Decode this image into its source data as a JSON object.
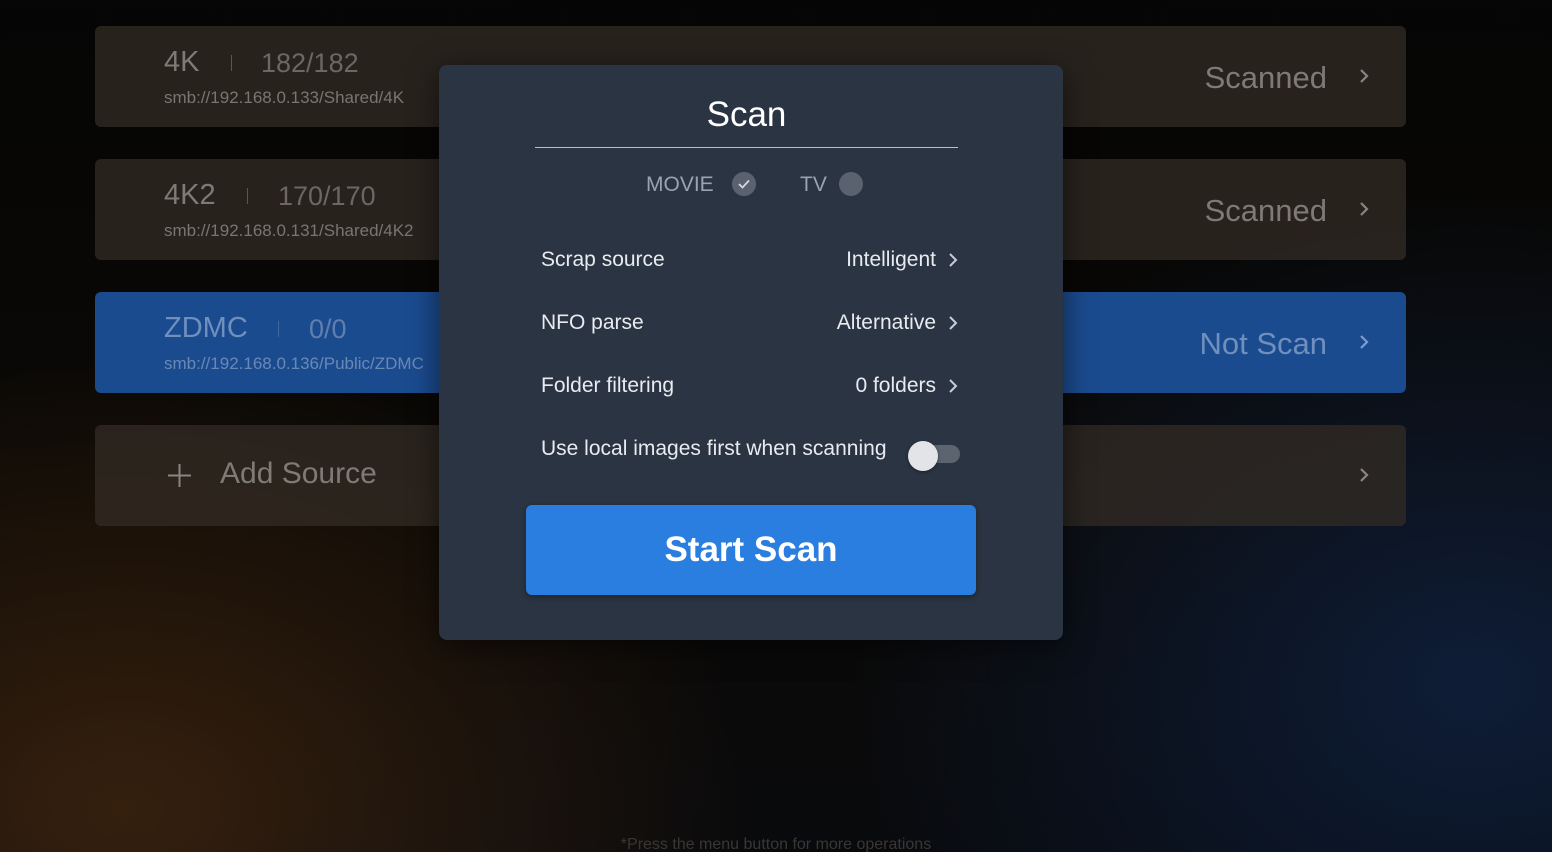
{
  "sources": [
    {
      "name": "4K",
      "count": "182/182",
      "path": "smb://192.168.0.133/Shared/4K",
      "status": "Scanned"
    },
    {
      "name": "4K2",
      "count": "170/170",
      "path": "smb://192.168.0.131/Shared/4K2",
      "status": "Scanned"
    },
    {
      "name": "ZDMC",
      "count": "0/0",
      "path": "smb://192.168.0.136/Public/ZDMC",
      "status": "Not Scan"
    }
  ],
  "add_source": {
    "label": "Add Source",
    "icon": "plus-icon"
  },
  "footnote": "*Press the menu button for more operations",
  "dialog": {
    "title": "Scan",
    "types": [
      {
        "label": "MOVIE",
        "selected": true
      },
      {
        "label": "TV",
        "selected": false
      }
    ],
    "settings": [
      {
        "label": "Scrap source",
        "value": "Intelligent"
      },
      {
        "label": "NFO parse",
        "value": "Alternative"
      },
      {
        "label": "Folder filtering",
        "value": "0 folders"
      }
    ],
    "toggle": {
      "label": "Use local images first when scanning",
      "on": false
    },
    "start_button": "Start Scan"
  },
  "colors": {
    "accent": "#2a7ee0",
    "active_row": "#1b4b8f",
    "dialog_bg": "#2b3442"
  }
}
